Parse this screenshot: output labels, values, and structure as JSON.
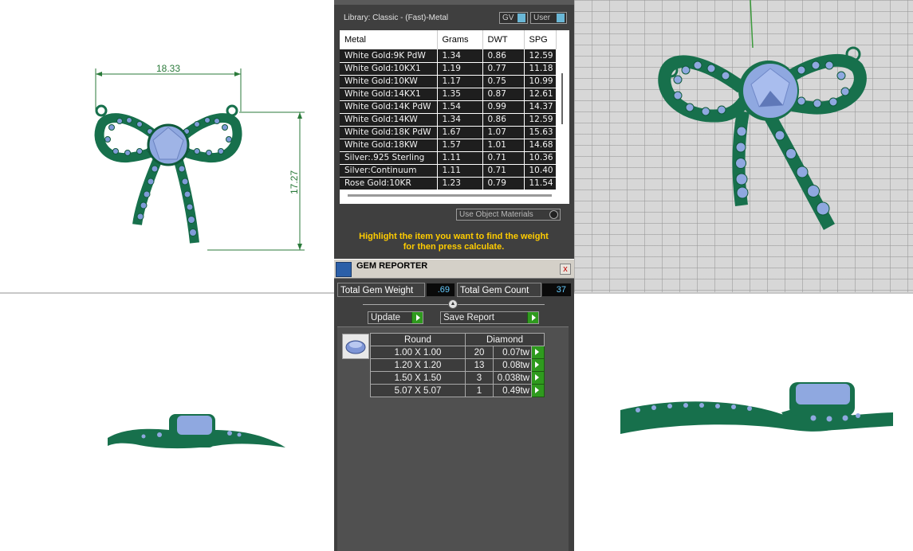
{
  "top_view": {
    "dim_width": "18.33",
    "dim_height": "17.27"
  },
  "metal_panel": {
    "library_label": "Library: Classic - (Fast)-Metal",
    "gv_label": "GV",
    "user_label": "User",
    "columns": [
      "Metal",
      "Grams",
      "DWT",
      "SPG"
    ],
    "rows": [
      [
        "White Gold:9K PdW",
        "1.34",
        "0.86",
        "12.59"
      ],
      [
        "White Gold:10KX1",
        "1.19",
        "0.77",
        "11.18"
      ],
      [
        "White Gold:10KW",
        "1.17",
        "0.75",
        "10.99"
      ],
      [
        "White Gold:14KX1",
        "1.35",
        "0.87",
        "12.61"
      ],
      [
        "White Gold:14K PdW",
        "1.54",
        "0.99",
        "14.37"
      ],
      [
        "White Gold:14KW",
        "1.34",
        "0.86",
        "12.59"
      ],
      [
        "White Gold:18K PdW",
        "1.67",
        "1.07",
        "15.63"
      ],
      [
        "White Gold:18KW",
        "1.57",
        "1.01",
        "14.68"
      ],
      [
        "Silver:.925 Sterling",
        "1.11",
        "0.71",
        "10.36"
      ],
      [
        "Silver:Continuum",
        "1.11",
        "0.71",
        "10.40"
      ],
      [
        "Rose Gold:10KR",
        "1.23",
        "0.79",
        "11.54"
      ]
    ],
    "use_object_materials": "Use Object Materials",
    "hint_line1": "Highlight the item you want to find the weight",
    "hint_line2": "for then press calculate."
  },
  "gem_reporter": {
    "title": "GEM REPORTER",
    "close_glyph": "x",
    "total_weight_label": "Total Gem Weight",
    "total_weight_value": ".69",
    "total_count_label": "Total Gem Count",
    "total_count_value": "37",
    "update_label": "Update",
    "save_report_label": "Save Report",
    "header_shape": "Round",
    "header_material": "Diamond",
    "rows": [
      {
        "size": "1.00 X 1.00",
        "count": "20",
        "tw": "0.07tw"
      },
      {
        "size": "1.20 X 1.20",
        "count": "13",
        "tw": "0.08tw"
      },
      {
        "size": "1.50 X 1.50",
        "count": "3",
        "tw": "0.038tw"
      },
      {
        "size": "5.07 X 5.07",
        "count": "1",
        "tw": "0.49tw"
      }
    ]
  },
  "colors": {
    "metal_green": "#1a7a55",
    "gem_blue": "#8fa8e0",
    "accent_yellow": "#ffcc00",
    "go_green": "#2f9a1e"
  }
}
